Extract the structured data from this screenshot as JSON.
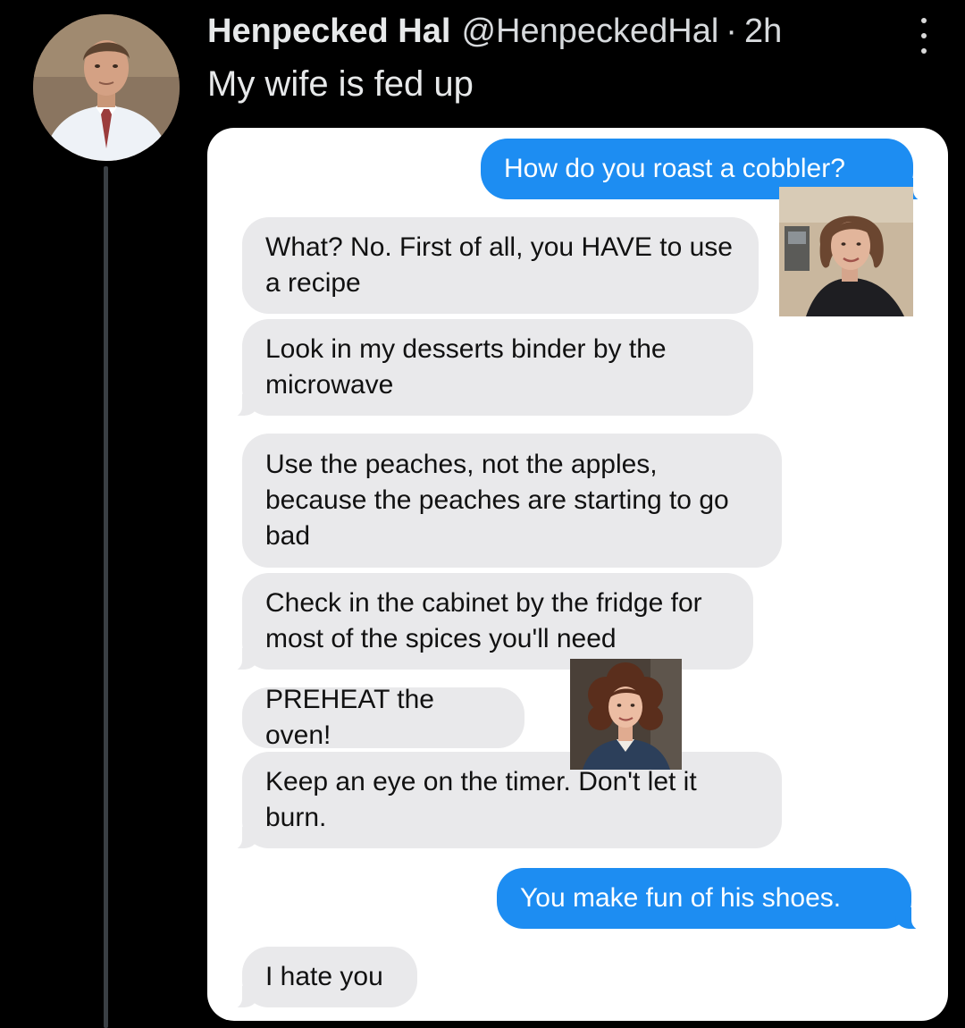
{
  "tweet": {
    "display_name": "Henpecked Hal",
    "handle": "@HenpeckedHal",
    "separator": "·",
    "time": "2h",
    "text": "My wife is fed up"
  },
  "icons": {
    "avatar": "man-portrait-avatar",
    "more": "more-vertical-icon"
  },
  "conversation": {
    "messages": [
      {
        "from": "me",
        "text": "How do you roast a cobbler?"
      },
      {
        "from": "them",
        "text": "What? No. First of all, you HAVE to use a recipe"
      },
      {
        "from": "them",
        "text": "Look in my desserts binder by the microwave"
      },
      {
        "from": "them",
        "text": "Use the peaches, not the apples, because the peaches are starting to go bad"
      },
      {
        "from": "them",
        "text": "Check in the cabinet by the fridge for most of the spices you'll need"
      },
      {
        "from": "them",
        "text": "PREHEAT the oven!"
      },
      {
        "from": "them",
        "text": "Keep an eye on the timer. Don't let it burn."
      },
      {
        "from": "me",
        "text": "You make fun of his shoes."
      },
      {
        "from": "them",
        "text": "I hate you"
      }
    ],
    "overlay_photos": [
      "woman-portrait-photo",
      "curly-hair-woman-photo"
    ]
  },
  "colors": {
    "background": "#000000",
    "outgoing_bubble": "#1d8df2",
    "incoming_bubble": "#e9e9eb",
    "thread_line": "#3a3f44"
  }
}
